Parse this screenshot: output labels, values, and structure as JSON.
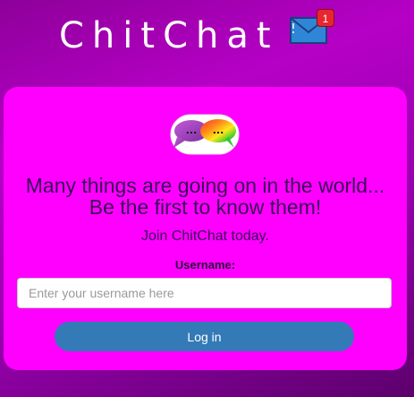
{
  "header": {
    "brand": "ChitChat",
    "notifications": {
      "count": "1",
      "icon": "envelope-icon"
    }
  },
  "login_card": {
    "logo_icon": "chat-bubbles-icon",
    "logo_dots_left": "...",
    "logo_dots_right": "...",
    "tagline_line1": "Many things are going on in the world...",
    "tagline_line2": "Be the first to know them!",
    "join_text": "Join ChitChat today.",
    "username_label": "Username:",
    "username_value": "",
    "username_placeholder": "Enter your username here",
    "login_label": "Log in"
  },
  "colors": {
    "card_background": "#ff00ff",
    "button_background": "#337ab7",
    "badge_background": "#e8262f"
  }
}
